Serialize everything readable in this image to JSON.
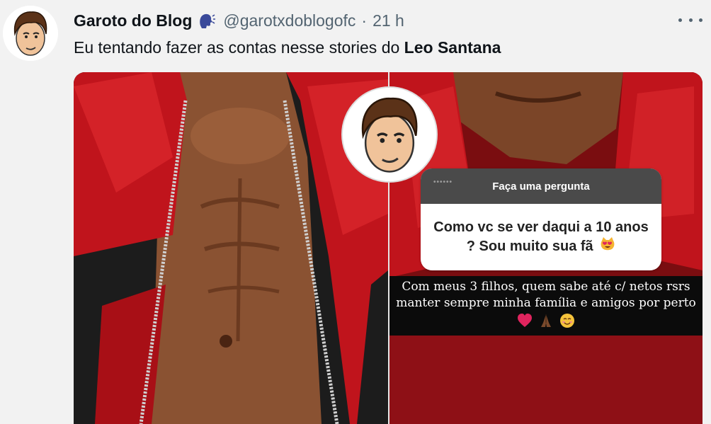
{
  "tweet": {
    "display_name": "Garoto do Blog",
    "name_emoji": "speaking-head-icon",
    "handle": "@garotxdoblogofc",
    "separator": "·",
    "time": "21 h",
    "text_prefix": "Eu tentando fazer as contas nesse stories do ",
    "text_bold": "Leo Santana"
  },
  "story": {
    "question_header": "Faça uma pergunta",
    "question_header_dim": "••••••",
    "question_text": "Como vc se ver daqui a 10 anos ? Sou muito sua fã",
    "question_emoji": "heart-eyes-cat-icon",
    "answer_line1": "Com meus 3 filhos, quem sabe até c/ netos rsrs",
    "answer_line2": "manter sempre minha família e amigos por perto",
    "answer_emojis": [
      "heart-icon",
      "praying-hands-icon",
      "smiling-face-icon"
    ]
  },
  "colors": {
    "jacket_red": "#c0141c",
    "leather_black": "#1c1c1c",
    "skin": "#8a5232",
    "text_gray": "#536471"
  }
}
